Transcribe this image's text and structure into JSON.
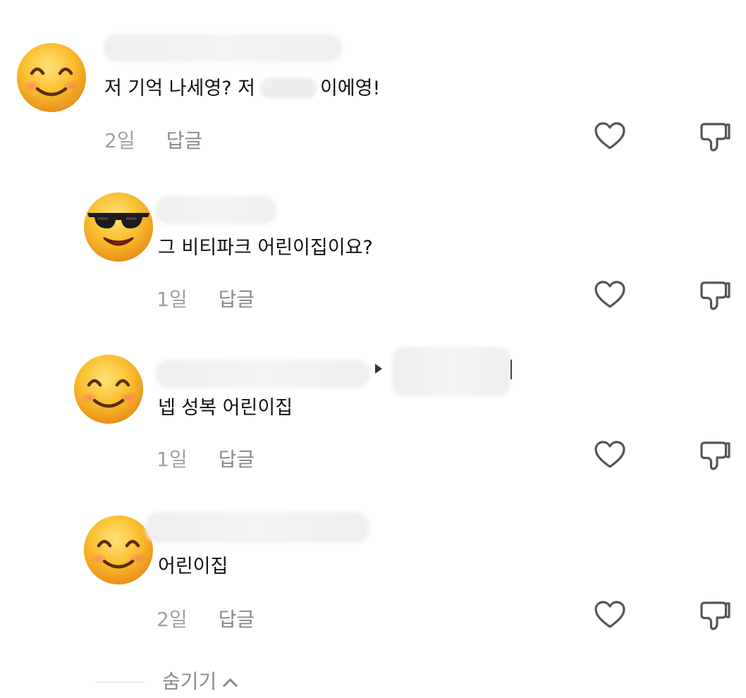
{
  "comments": [
    {
      "avatar": "smiling-face-icon",
      "text_before": "저 기억 나세영? 저",
      "text_after": "이에영!",
      "time": "2일",
      "reply_label": "답글"
    },
    {
      "avatar": "sunglasses-face-icon",
      "text": "그 비티파크 어린이집이요?",
      "time": "1일",
      "reply_label": "답글"
    },
    {
      "avatar": "smiling-face-icon",
      "text": "넵 성복 어린이집",
      "time": "1일",
      "reply_label": "답글"
    },
    {
      "avatar": "smiling-face-icon",
      "text": "어린이집",
      "time": "2일",
      "reply_label": "답글"
    }
  ],
  "footer": {
    "hide_label": "숨기기"
  },
  "colors": {
    "meta_gray": "#8e8e93",
    "icon_gray": "#555555",
    "emoji_yellow": "#f7b52a"
  }
}
